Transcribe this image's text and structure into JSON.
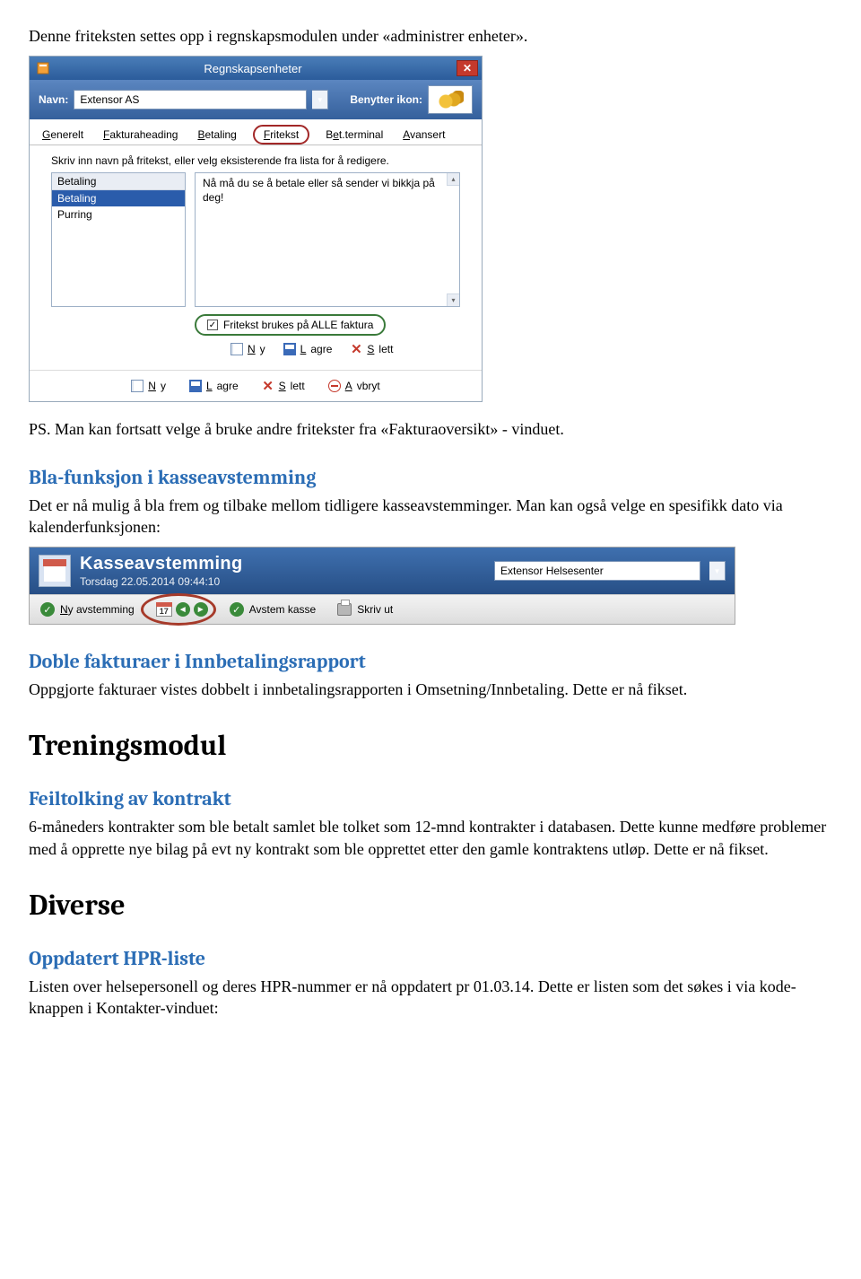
{
  "para_intro": "Denne friteksten settes opp i regnskapsmodulen under «administrer enheter».",
  "win1": {
    "title": "Regnskapsenheter",
    "name_label": "Navn:",
    "name_value": "Extensor AS",
    "ikon_label": "Benytter ikon:",
    "tabs": {
      "generelt": "Generelt",
      "fakturaheading": "Fakturaheading",
      "betaling": "Betaling",
      "fritekst": "Fritekst",
      "betterminal": "Bet.terminal",
      "avansert": "Avansert"
    },
    "hint": "Skriv inn navn på fritekst, eller velg eksisterende fra lista for å redigere.",
    "list_head": "Betaling",
    "list_items": [
      "Betaling",
      "Purring"
    ],
    "text_area": "Nå må du se å betale eller så sender vi bikkja på deg!",
    "checkbox": "Fritekst brukes på ALLE faktura",
    "btn_ny": "Ny",
    "btn_lagre": "Lagre",
    "btn_slett": "Slett",
    "btn_avbryt": "Avbryt"
  },
  "para_ps": "PS. Man kan fortsatt velge å bruke andre fritekster fra «Fakturaoversikt» - vinduet.",
  "h_bla": "Bla-funksjon i kasseavstemming",
  "para_bla": "Det er nå mulig å bla frem og tilbake mellom tidligere kasseavstemminger. Man kan også velge en spesifikk dato via kalenderfunksjonen:",
  "win2": {
    "title": "Kasseavstemming",
    "sub": "Torsdag 22.05.2014 09:44:10",
    "select_value": "Extensor Helsesenter",
    "btn_ny": "Ny avstemming",
    "cal_label": "17",
    "btn_avstem": "Avstem kasse",
    "btn_print": "Skriv ut"
  },
  "h_doble": "Doble fakturaer i Innbetalingsrapport",
  "para_doble": "Oppgjorte fakturaer vistes dobbelt i innbetalingsrapporten i Omsetning/Innbetaling. Dette er nå fikset.",
  "h_trening": "Treningsmodul",
  "h_feiltolk": "Feiltolking av kontrakt",
  "para_feiltolk": "6-måneders kontrakter som ble betalt samlet ble tolket som 12-mnd kontrakter i databasen. Dette kunne medføre problemer med å opprette nye bilag på evt ny kontrakt som ble opprettet etter den gamle kontraktens utløp. Dette er nå fikset.",
  "h_diverse": "Diverse",
  "h_hpr": "Oppdatert HPR-liste",
  "para_hpr": "Listen over helsepersonell og deres HPR-nummer er nå oppdatert pr 01.03.14. Dette er listen som det søkes i via kode-knappen i Kontakter-vinduet:"
}
